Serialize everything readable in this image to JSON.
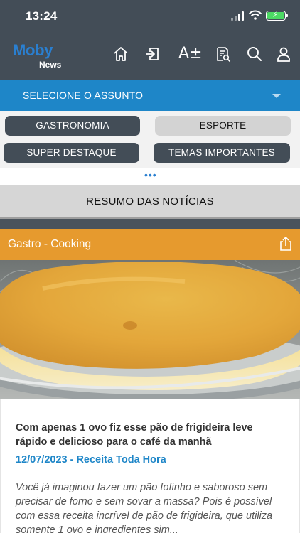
{
  "status_bar": {
    "time": "13:24"
  },
  "app": {
    "logo_line1": "Moby",
    "logo_line2": "News"
  },
  "toolbar_icons": [
    "home-icon",
    "login-icon",
    "font-size-icon",
    "search-document-icon",
    "search-icon",
    "user-icon"
  ],
  "toolbar": {
    "font_size_glyph": "A±"
  },
  "subject_selector": {
    "label": "SELECIONE O ASSUNTO"
  },
  "categories": [
    {
      "label": "GASTRONOMIA",
      "selected": true
    },
    {
      "label": "ESPORTE",
      "selected": false
    },
    {
      "label": "SUPER DESTAQUE",
      "selected": true
    },
    {
      "label": "TEMAS IMPORTANTES",
      "selected": true
    }
  ],
  "pager_dots": "•••",
  "summary_button": {
    "label": "RESUMO DAS NOTÍCIAS"
  },
  "card": {
    "category": "Gastro - Cooking",
    "headline": "Com apenas 1 ovo fiz esse pão de frigideira leve rápido e delicioso para o café da manhã",
    "meta": "12/07/2023 - Receita Toda Hora",
    "excerpt": "Você já imaginou fazer um pão fofinho e saboroso sem precisar de forno e sem sovar a massa? Pois é possível com essa receita incrível de pão de frigideira, que utiliza somente 1 ovo e ingredientes sim..."
  },
  "colors": {
    "topbar": "#434d57",
    "subject_bar": "#1e86c8",
    "card_header": "#e69a2e",
    "meta_text": "#1e86c8"
  }
}
